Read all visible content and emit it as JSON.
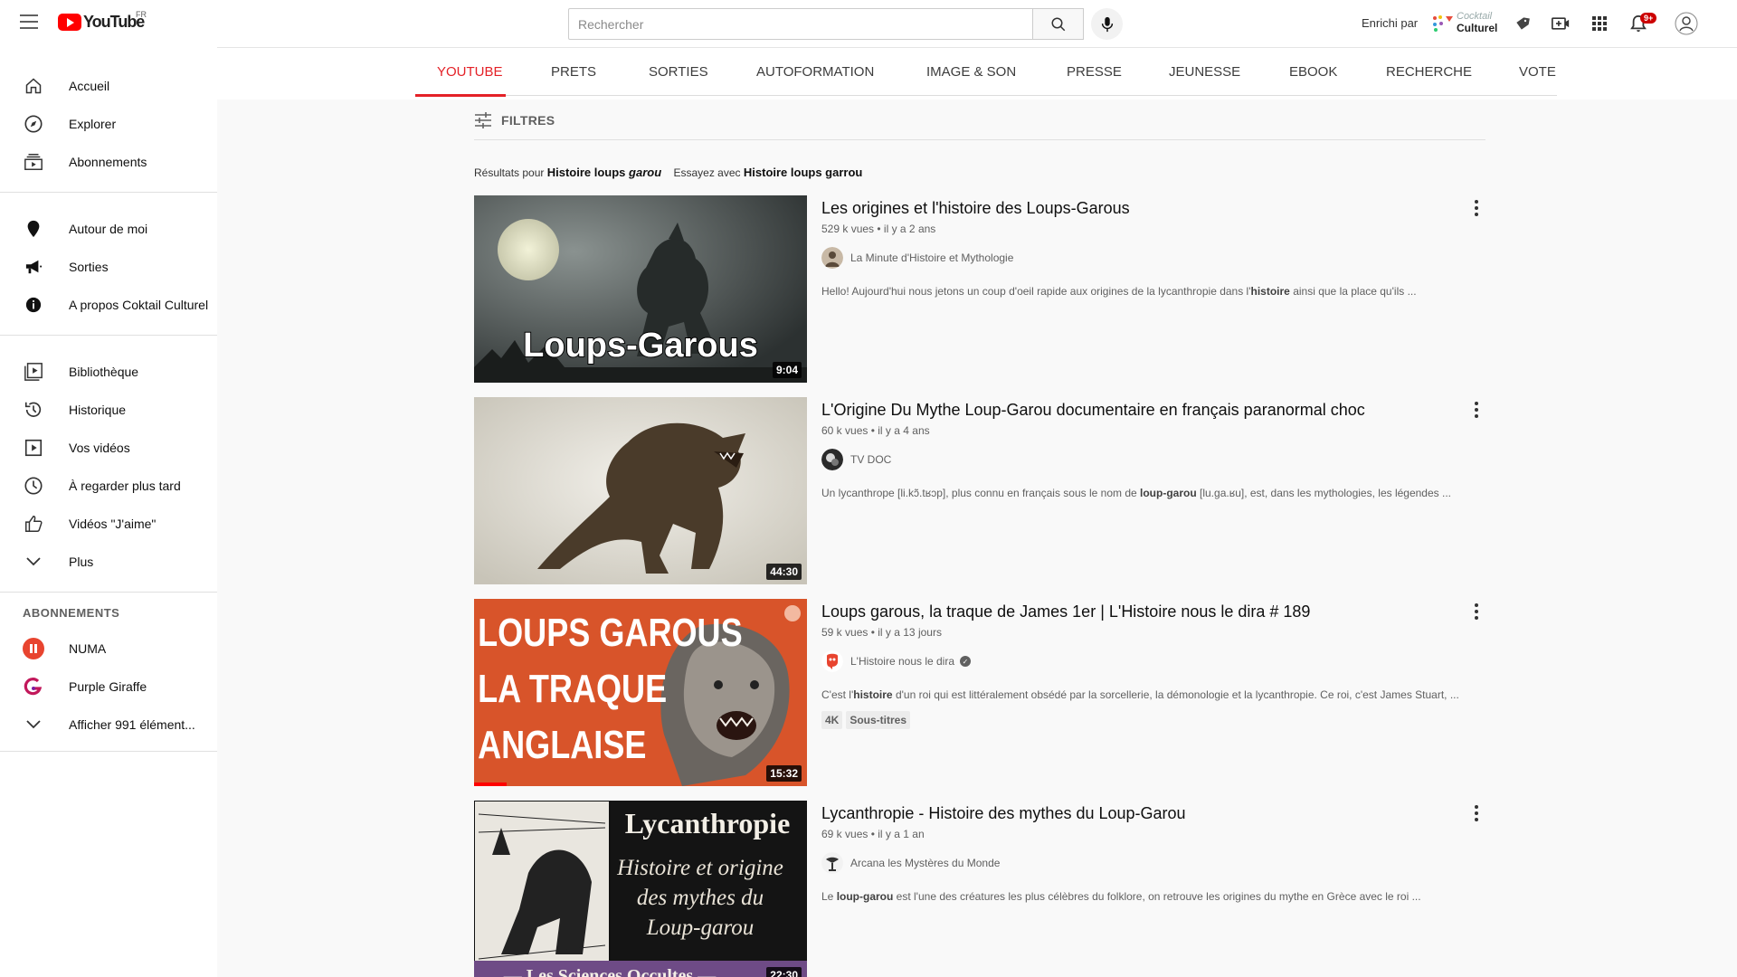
{
  "header": {
    "logo_text": "YouTube",
    "country_code": "FR",
    "search_placeholder": "Rechercher",
    "enrichi_label": "Enrichi par",
    "partner_logo_line1": "Cocktail",
    "partner_logo_line2": "Culturel",
    "notification_count": "9+"
  },
  "sidebar": {
    "main": [
      {
        "label": "Accueil",
        "icon": "home-icon"
      },
      {
        "label": "Explorer",
        "icon": "compass-icon"
      },
      {
        "label": "Abonnements",
        "icon": "subscriptions-icon"
      }
    ],
    "partner": [
      {
        "label": "Autour de moi",
        "icon": "location-pin-icon"
      },
      {
        "label": "Sorties",
        "icon": "megaphone-icon"
      },
      {
        "label": "A propos Coktail Culturel",
        "icon": "info-icon"
      }
    ],
    "library": [
      {
        "label": "Bibliothèque",
        "icon": "library-icon"
      },
      {
        "label": "Historique",
        "icon": "history-icon"
      },
      {
        "label": "Vos vidéos",
        "icon": "your-videos-icon"
      },
      {
        "label": "À regarder plus tard",
        "icon": "watch-later-icon"
      },
      {
        "label": "Vidéos \"J'aime\"",
        "icon": "thumbs-up-icon"
      },
      {
        "label": "Plus",
        "icon": "chevron-down-icon"
      }
    ],
    "subscriptions_heading": "ABONNEMENTS",
    "subscriptions": [
      {
        "label": "NUMA",
        "icon": "numa-avatar"
      },
      {
        "label": "Purple Giraffe",
        "icon": "purple-giraffe-avatar"
      },
      {
        "label": "Afficher 991 élément...",
        "icon": "chevron-down-icon"
      }
    ]
  },
  "tabs": [
    "YOUTUBE",
    "PRETS",
    "SORTIES",
    "AUTOFORMATION",
    "IMAGE & SON",
    "PRESSE",
    "JEUNESSE",
    "EBOOK",
    "RECHERCHE",
    "VOTE"
  ],
  "active_tab": "YOUTUBE",
  "filters_label": "FILTRES",
  "results": {
    "prefix": "Résultats pour",
    "query_part1": "Histoire loups",
    "query_part2": "garou",
    "suggest_prefix": "Essayez avec",
    "suggestion": "Histoire loups garrou"
  },
  "videos": [
    {
      "title": "Les origines et l'histoire des Loups-Garous",
      "views": "529 k vues",
      "age": "il y a 2 ans",
      "channel": "La Minute d'Histoire et Mythologie",
      "verified": false,
      "desc_before": "Hello! Aujourd'hui nous jetons un coup d'oeil rapide aux origines de la lycanthropie dans l'",
      "desc_bold": "histoire",
      "desc_after": " ainsi que la place qu'ils ...",
      "duration": "9:04",
      "thumb_text": "Loups-Garous",
      "badges": []
    },
    {
      "title": "L'Origine Du Mythe Loup-Garou documentaire en français paranormal choc",
      "views": "60 k vues",
      "age": "il y a 4 ans",
      "channel": "TV DOC",
      "verified": false,
      "desc_before": "Un lycanthrope [li.kɔ̃.tʁɔp], plus connu en français sous le nom de ",
      "desc_bold": "loup-garou",
      "desc_after": " [lu.ga.ʁu], est, dans les mythologies, les légendes ...",
      "duration": "44:30",
      "thumb_text": "",
      "badges": []
    },
    {
      "title": "Loups garous, la traque de James 1er | L'Histoire nous le dira # 189",
      "views": "59 k vues",
      "age": "il y a 13 jours",
      "channel": "L'Histoire nous le dira",
      "verified": true,
      "desc_before": "C'est l'",
      "desc_bold": "histoire",
      "desc_after": " d'un roi qui est littéralement obsédé par la sorcellerie, la démonologie et la lycanthropie. Ce roi, c'est James Stuart, ...",
      "duration": "15:32",
      "thumb_lines": [
        "LOUPS GAROUS",
        "LA TRAQUE",
        "ANGLAISE"
      ],
      "badges": [
        "4K",
        "Sous-titres"
      ]
    },
    {
      "title": "Lycanthropie - Histoire des mythes du Loup-Garou",
      "views": "69 k vues",
      "age": "il y a 1 an",
      "channel": "Arcana les Mystères du Monde",
      "verified": false,
      "desc_before": "Le ",
      "desc_bold": "loup-garou",
      "desc_after": " est l'une des créatures les plus célèbres du folklore, on retrouve les origines du mythe en Grèce avec le roi ...",
      "duration": "22:30",
      "thumb_title": "Lycanthropie",
      "thumb_lines": [
        "Histoire et origine",
        "des mythes du",
        "Loup-garou"
      ],
      "thumb_footer": "— Les Sciences Occultes —",
      "badges": []
    }
  ],
  "colors": {
    "accent_red": "#e42127",
    "youtube_red": "#ff0000",
    "thumb3_orange": "#d8542a"
  }
}
